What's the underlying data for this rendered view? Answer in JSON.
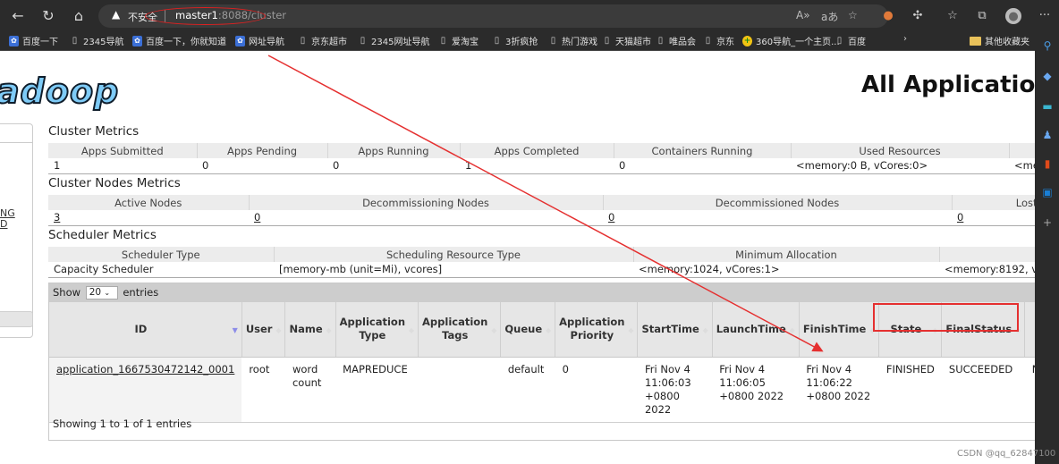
{
  "browser": {
    "security_label": "不安全",
    "url_host": "master1",
    "url_path": ":8088/cluster",
    "bookmarks": [
      {
        "label": "百度一下",
        "icon": "baidu-paw-icon"
      },
      {
        "label": "2345导航",
        "icon": "page-icon"
      },
      {
        "label": "百度一下，你就知道",
        "icon": "baidu-paw-icon"
      },
      {
        "label": "网址导航",
        "icon": "baidu-paw-icon"
      },
      {
        "label": "京东超市",
        "icon": "page-icon"
      },
      {
        "label": "2345网址导航",
        "icon": "page-icon"
      },
      {
        "label": "爱淘宝",
        "icon": "page-icon"
      },
      {
        "label": "3折疯抢",
        "icon": "page-icon"
      },
      {
        "label": "热门游戏",
        "icon": "page-icon"
      },
      {
        "label": "天猫超市",
        "icon": "page-icon"
      },
      {
        "label": "唯品会",
        "icon": "page-icon"
      },
      {
        "label": "京东",
        "icon": "page-icon"
      },
      {
        "label": "360导航_一个主页...",
        "icon": "360-icon"
      },
      {
        "label": "百度",
        "icon": "page-icon"
      }
    ],
    "other_bookmarks": "其他收藏夹"
  },
  "page": {
    "logo_text": "adoop",
    "title": "All Applications",
    "sidebar_links": [
      "NG",
      "D"
    ]
  },
  "cluster_metrics": {
    "title": "Cluster Metrics",
    "headers": [
      "Apps Submitted",
      "Apps Pending",
      "Apps Running",
      "Apps Completed",
      "Containers Running",
      "Used Resources",
      ""
    ],
    "values": [
      "1",
      "0",
      "0",
      "1",
      "0",
      "<memory:0 B, vCores:0>",
      "<me"
    ]
  },
  "cluster_nodes_metrics": {
    "title": "Cluster Nodes Metrics",
    "headers": [
      "Active Nodes",
      "Decommissioning Nodes",
      "Decommissioned Nodes",
      "Lost"
    ],
    "values": [
      "3",
      "0",
      "0",
      "0"
    ]
  },
  "scheduler_metrics": {
    "title": "Scheduler Metrics",
    "headers": [
      "Scheduler Type",
      "Scheduling Resource Type",
      "Minimum Allocation",
      ""
    ],
    "values": [
      "Capacity Scheduler",
      "[memory-mb (unit=Mi), vcores]",
      "<memory:1024, vCores:1>",
      "<memory:8192, vC"
    ]
  },
  "apps_table": {
    "show_label": "Show",
    "page_length": "20",
    "entries_label": "entries",
    "columns": [
      "ID",
      "User",
      "Name",
      "Application Type",
      "Application Tags",
      "Queue",
      "Application Priority",
      "StartTime",
      "LaunchTime",
      "FinishTime",
      "State",
      "FinalStatus",
      ""
    ],
    "rows": [
      {
        "id": "application_1667530472142_0001",
        "user": "root",
        "name": "word count",
        "type": "MAPREDUCE",
        "tags": "",
        "queue": "default",
        "priority": "0",
        "start_time": "Fri Nov 4 11:06:03 +0800 2022",
        "launch_time": "Fri Nov 4 11:06:05 +0800 2022",
        "finish_time": "Fri Nov 4 11:06:22 +0800 2022",
        "state": "FINISHED",
        "final_status": "SUCCEEDED",
        "extra": "N"
      }
    ],
    "info": "Showing 1 to 1 of 1 entries"
  },
  "watermark": "CSDN @qq_62847100",
  "annotation_color": "#e53030"
}
